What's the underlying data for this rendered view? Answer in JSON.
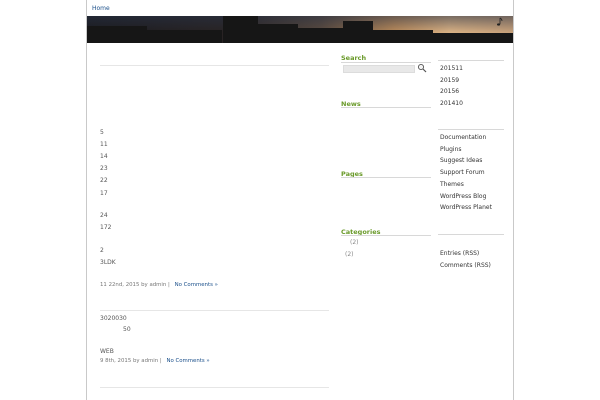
{
  "nav": {
    "home_label": "Home"
  },
  "posts": [
    {
      "lines": [
        "5",
        "11",
        "14",
        "23",
        "22",
        "17",
        "24",
        "172",
        "2",
        "3LDK"
      ],
      "meta_prefix": "11 22nd, 2015 by admin |",
      "comments_label": "No Comments »"
    },
    {
      "lines": [
        "3020030",
        "50",
        "WEB"
      ],
      "meta_prefix": "9 8th, 2015 by admin |",
      "comments_label": "No Comments »"
    }
  ],
  "sidebar": {
    "search_heading": "Search",
    "search_placeholder": "",
    "news_heading": "News",
    "pages_heading": "Pages",
    "categories_heading": "Categories",
    "categories": [
      {
        "count": "(2)"
      },
      {
        "count": "(2)"
      }
    ]
  },
  "right_sidebar": {
    "archives": [
      "201511",
      "20159",
      "20156",
      "201410"
    ],
    "links": [
      "Documentation",
      "Plugins",
      "Suggest Ideas",
      "Support Forum",
      "Themes",
      "WordPress Blog",
      "WordPress Planet"
    ],
    "meta": [
      "Entries (RSS)",
      "Comments (RSS)"
    ]
  },
  "colors": {
    "accent_heading": "#6a9a2a",
    "link": "#1a4f8a"
  },
  "icons": {
    "search": "magnifier-icon",
    "header_note": "music-note-icon"
  }
}
